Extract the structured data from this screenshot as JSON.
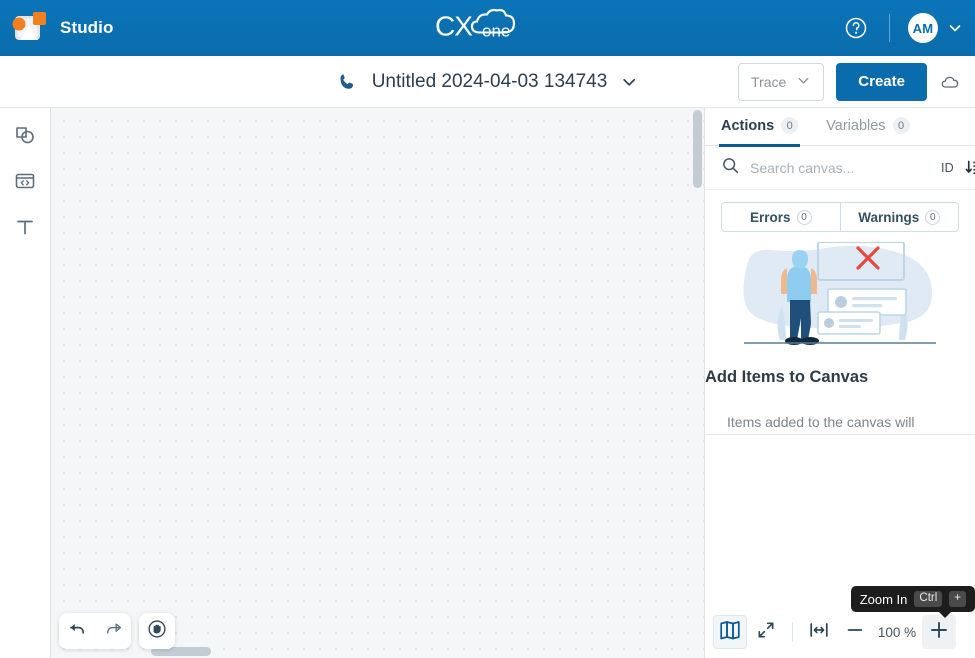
{
  "header": {
    "app_name": "Studio",
    "logo_icon": "studio-logo-icon",
    "brand_logo": "cxone-cloud-logo",
    "brand_text_cx": "CX",
    "brand_text_one": "one",
    "help_icon": "help-circle-icon",
    "avatar_initials": "AM",
    "avatar_caret_icon": "chevron-down-icon",
    "brand_color": "#0a6cad"
  },
  "toolbar": {
    "phone_icon": "phone-icon",
    "flow_title": "Untitled 2024-04-03 134743",
    "title_caret_icon": "chevron-down-icon",
    "trace_label": "Trace",
    "trace_caret_icon": "chevron-down-icon",
    "create_label": "Create",
    "cloud_icon": "cloud-icon"
  },
  "sidebar": {
    "items": [
      {
        "icon": "shapes-tool-icon",
        "name": "sidebar-item-shapes"
      },
      {
        "icon": "code-window-icon",
        "name": "sidebar-item-code"
      },
      {
        "icon": "text-tool-icon",
        "name": "sidebar-item-text"
      }
    ]
  },
  "canvas": {
    "undo_icon": "undo-arrow-icon",
    "redo_icon": "redo-arrow-icon",
    "pan_icon": "hand-pan-icon",
    "vertical_scrollbar": "canvas-vertical-scrollbar",
    "horizontal_scrollbar": "canvas-horizontal-scrollbar"
  },
  "panel": {
    "tabs": [
      {
        "label": "Actions",
        "badge": "0",
        "active": true
      },
      {
        "label": "Variables",
        "badge": "0",
        "active": false
      }
    ],
    "search": {
      "icon": "search-icon",
      "placeholder": "Search canvas...",
      "value": "",
      "sort_label": "ID",
      "sort_icon": "sort-descending-icon"
    },
    "filters": [
      {
        "label": "Errors",
        "badge": "0"
      },
      {
        "label": "Warnings",
        "badge": "0"
      }
    ],
    "empty_state": {
      "illustration": "person-empty-canvas-illustration",
      "title": "Add Items to Canvas",
      "description": "Items added to the canvas will"
    },
    "zoom": {
      "minimap_icon": "minimap-book-icon",
      "fullscreen_icon": "expand-diagonal-icon",
      "fit_width_icon": "fit-to-width-icon",
      "zoom_out_icon": "minus-icon",
      "zoom_level": "100 %",
      "zoom_in_icon": "plus-icon",
      "tooltip": {
        "text": "Zoom In",
        "key_modifier": "Ctrl",
        "key_main": "+"
      }
    }
  }
}
